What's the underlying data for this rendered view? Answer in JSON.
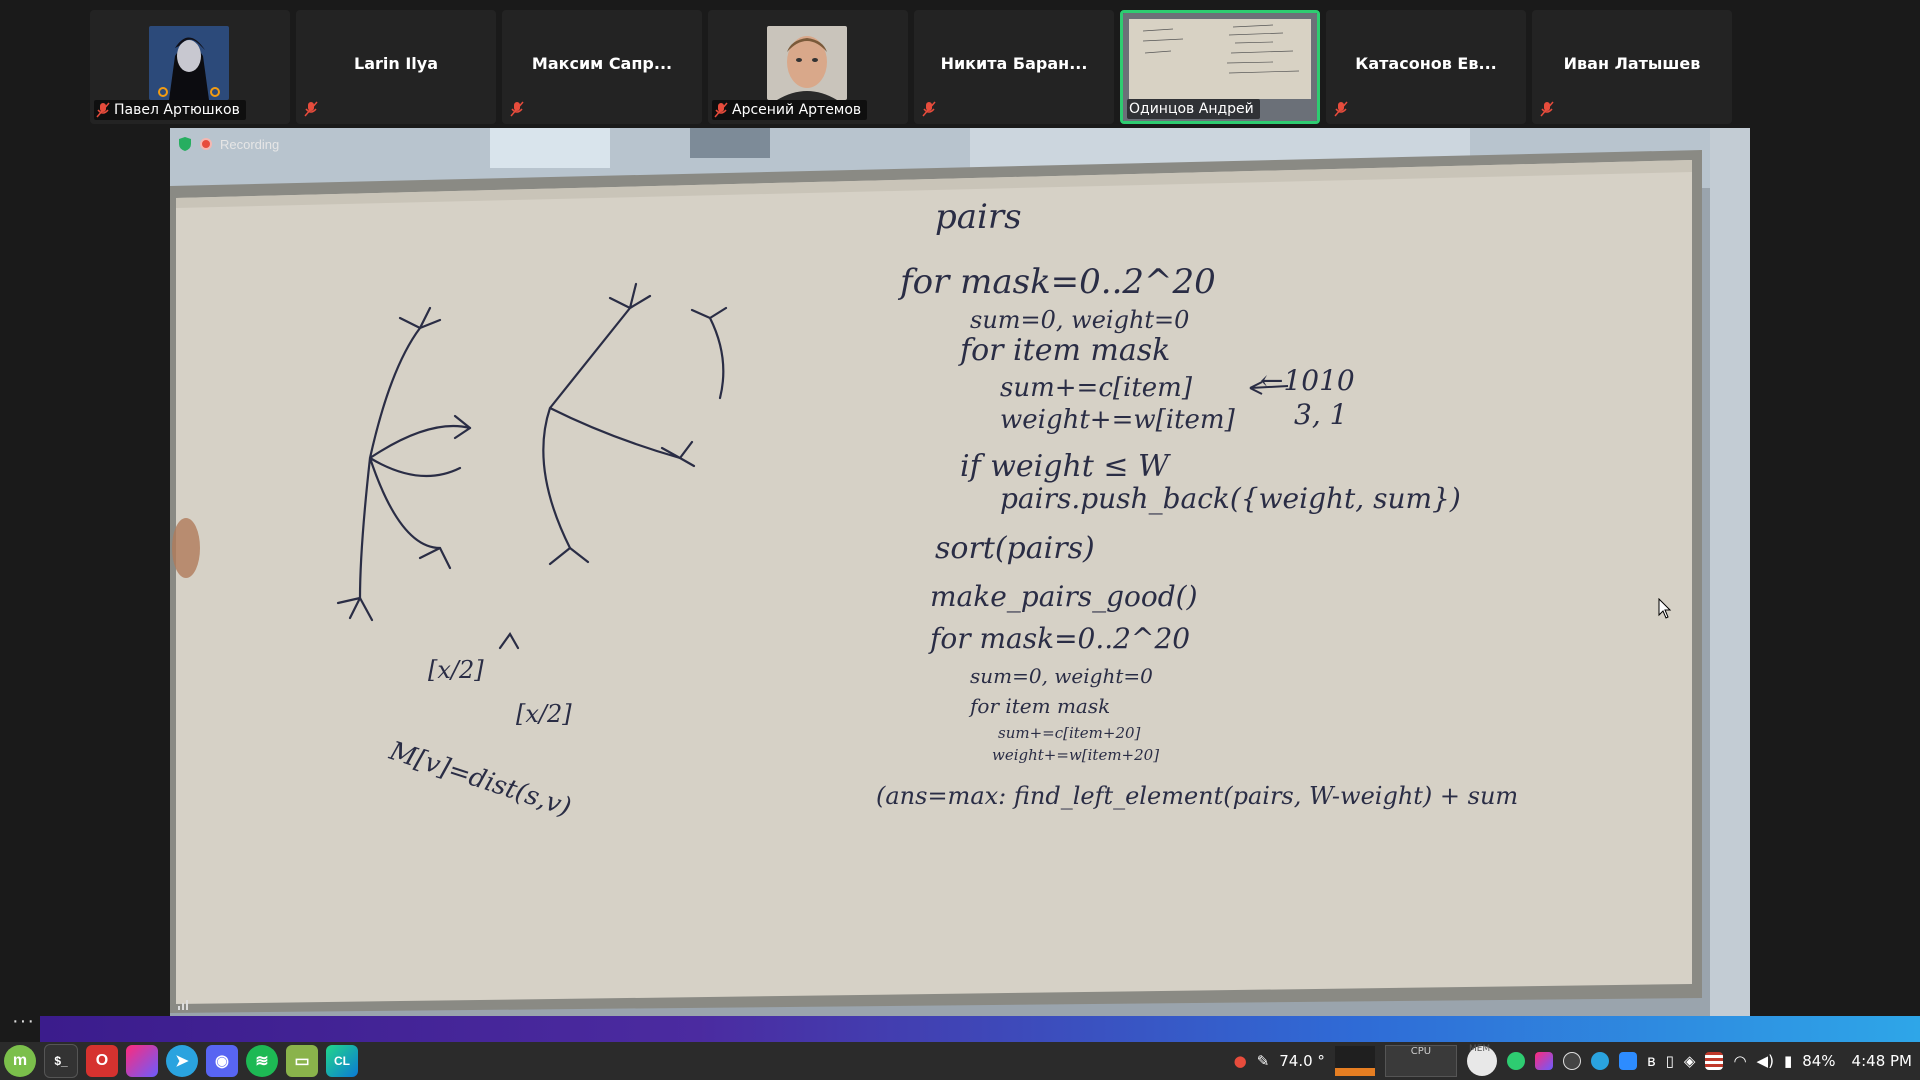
{
  "participants": [
    {
      "name": "Павел Артюшков",
      "display": "avatar",
      "muted": true
    },
    {
      "name": "Larin Ilya",
      "display": "name",
      "muted": true
    },
    {
      "name": "Максим Сапр...",
      "display": "name",
      "muted": true
    },
    {
      "name": "Арсений Артемов",
      "display": "avatar",
      "muted": true
    },
    {
      "name": "Никита Баран...",
      "display": "name",
      "muted": true
    },
    {
      "name": "Одинцов Андрей",
      "display": "video",
      "muted": false,
      "active": true
    },
    {
      "name": "Катасонов Ев...",
      "display": "name",
      "muted": true
    },
    {
      "name": "Иван Латышев",
      "display": "name",
      "muted": true
    }
  ],
  "video": {
    "recording_label": "Recording",
    "whiteboard": {
      "lines": [
        "pairs",
        "for mask=0..2^20",
        "sum=0, weight=0",
        "for item mask",
        "sum+=c[item]",
        "weight+=w[item]",
        "if weight ≤ W",
        "pairs.push_back({weight, sum})",
        "sort(pairs)",
        "make_pairs_good()",
        "for mask=0..2^20",
        "sum=0, weight=0",
        "for item mask",
        "sum+=c[item+20]",
        "weight+=w[item+20]",
        "(ans=max: find_left_element(pairs, W-weight) + sum",
        "←1010",
        "3, 1",
        "[x/2]",
        "[x/2]",
        "M[v]=dist(s,v)"
      ]
    }
  },
  "taskbar": {
    "apps": [
      "mint-menu",
      "terminal",
      "opera",
      "jetbrains-toolbox",
      "telegram",
      "discord",
      "spotify",
      "files",
      "clion"
    ],
    "temperature": "74.0 °",
    "cpu_label": "CPU",
    "mem_label": "MEM",
    "battery": "84%",
    "time": "4:48 PM"
  },
  "colors": {
    "active_border": "#2ecc71",
    "recording_dot": "#e74c3c",
    "muted_icon": "#e74c3c"
  }
}
